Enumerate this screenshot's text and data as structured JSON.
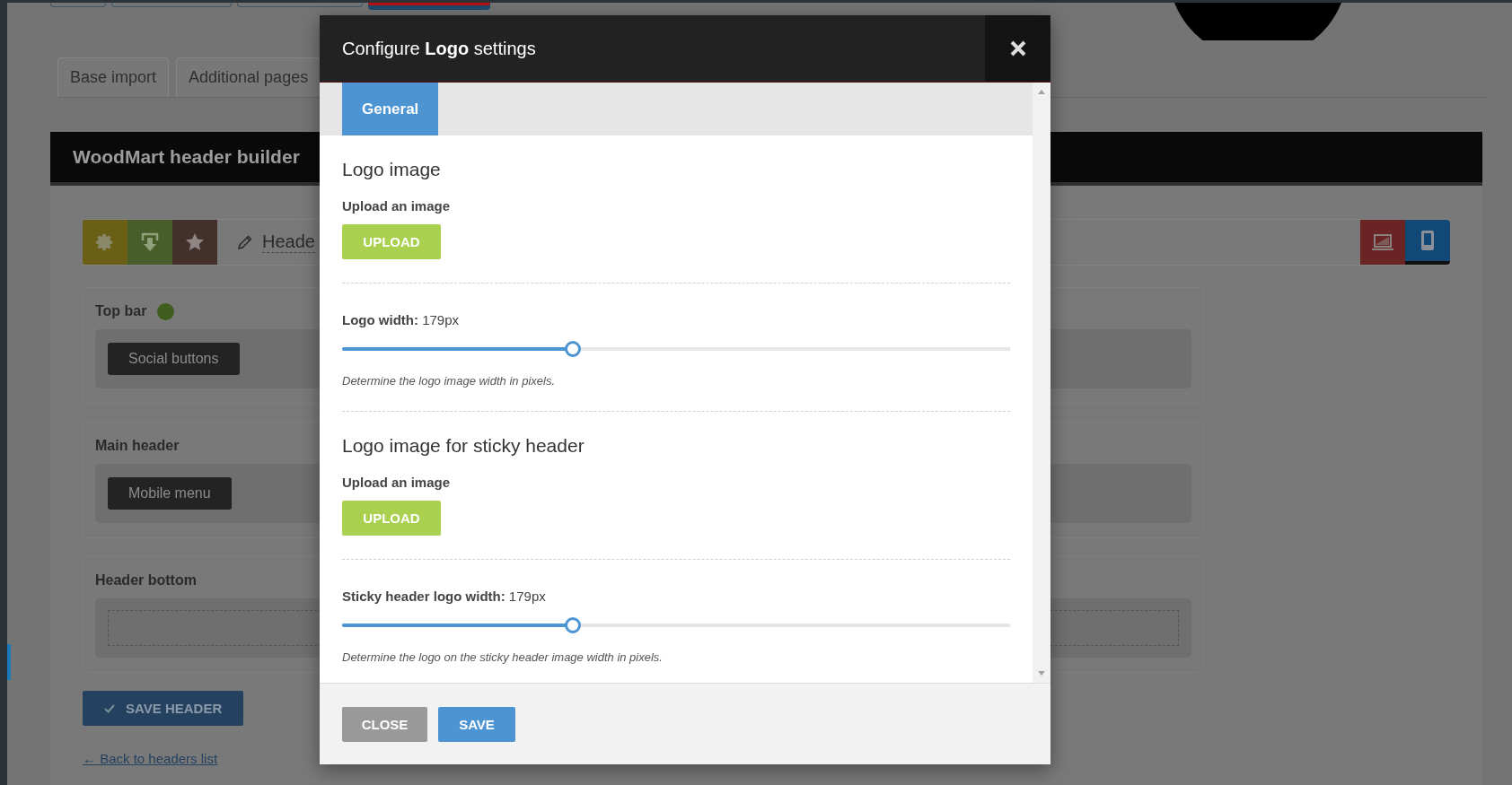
{
  "page_tabs": [
    {
      "label": "Base import",
      "selected": false
    },
    {
      "label": "Additional pages",
      "selected": false
    }
  ],
  "builder": {
    "title": "WoodMart header builder",
    "tools": [
      {
        "kind": "settings"
      },
      {
        "kind": "import"
      },
      {
        "kind": "favorite"
      }
    ],
    "header_name": "Heade",
    "devices": [
      {
        "kind": "desktop",
        "selected": false
      },
      {
        "kind": "mobile",
        "selected": true
      }
    ],
    "rows": [
      {
        "title": "Top bar",
        "color": "#3f5e1e",
        "elements": [
          "Social buttons"
        ]
      },
      {
        "title": "Main header",
        "elements": [
          "Mobile menu"
        ]
      },
      {
        "title": "Header bottom"
      }
    ],
    "save_button": "SAVE HEADER",
    "back_link": "← Back to headers list"
  },
  "modal": {
    "title": "Configure **Logo** settings",
    "tabs": [
      {
        "label": "General",
        "selected": true
      }
    ],
    "sections": [
      {
        "heading": "Logo image",
        "upload_label": "Upload an image",
        "upload_button": "UPLOAD",
        "slider_label": "**Logo width:** 179px",
        "level": 0.344,
        "hint": "Determine the logo image width in pixels."
      },
      {
        "heading": "Logo image for sticky header",
        "upload_label": "Upload an image",
        "upload_button": "UPLOAD",
        "slider_label": "**Sticky header logo width:** 179px",
        "level": 0.344,
        "hint": "Determine the logo on the sticky header image width in pixels."
      }
    ],
    "buttons": [
      {
        "kind": "close",
        "label": "CLOSE"
      },
      {
        "kind": "save",
        "label": "SAVE"
      }
    ]
  }
}
